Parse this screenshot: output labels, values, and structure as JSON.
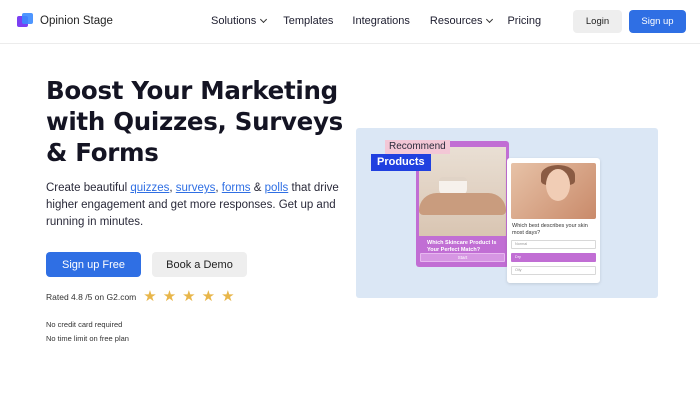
{
  "header": {
    "logo_text": "Opinion Stage",
    "nav": [
      {
        "label": "Solutions",
        "dropdown": true
      },
      {
        "label": "Templates",
        "dropdown": false
      },
      {
        "label": "Integrations",
        "dropdown": false
      },
      {
        "label": "Resources",
        "dropdown": true
      },
      {
        "label": "Pricing",
        "dropdown": false
      }
    ],
    "login_label": "Login",
    "signup_label": "Sign up"
  },
  "hero": {
    "title": "Boost Your Marketing with Quizzes, Surveys & Forms",
    "sub_prefix": "Create beautiful ",
    "link_quizzes": "quizzes",
    "sep1": ", ",
    "link_surveys": "surveys",
    "sep2": ", ",
    "link_forms": "forms",
    "sep3": " & ",
    "link_polls": "polls",
    "sub_suffix": " that drive higher engagement and get more responses. Get up and running in minutes.",
    "primary_cta": "Sign up Free",
    "secondary_cta": "Book a Demo",
    "rating_text": "Rated 4.8 /5 on G2.com",
    "stars": 5,
    "note_1": "No credit card required",
    "note_2": "No time limit on free plan"
  },
  "preview": {
    "tag_recommend": "Recommend",
    "tag_products": "Products",
    "card1_question": "Which Skincare Product Is Your Perfect Match?",
    "card1_button": "Start",
    "card2_question": "Which best describes your skin most days?",
    "card2_options": [
      "Normal",
      "Dry",
      "Oily"
    ]
  },
  "colors": {
    "accent": "#2f6fe4",
    "star": "#e8b64a",
    "card_purple": "#c16ed4",
    "preview_bg": "#dbe7f5"
  }
}
